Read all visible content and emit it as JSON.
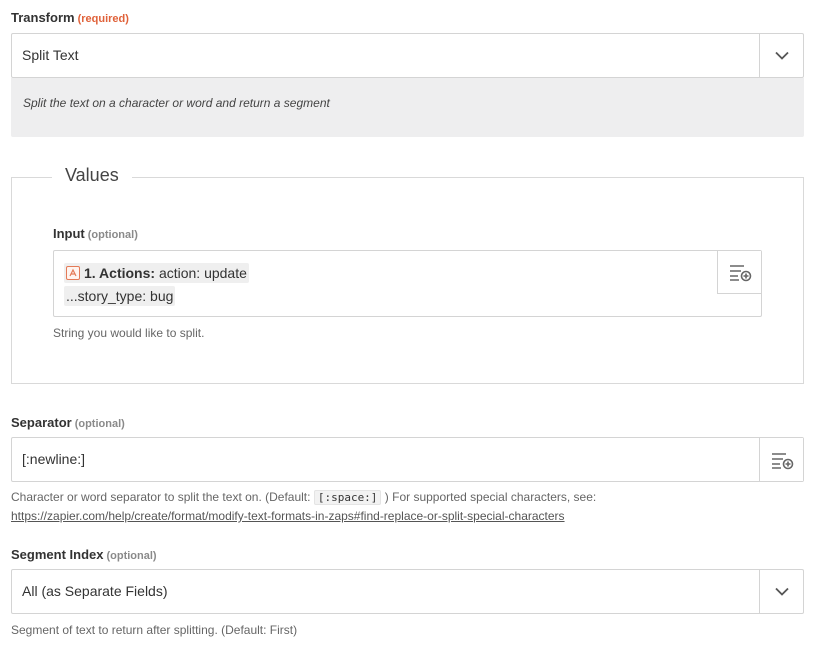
{
  "transform": {
    "label": "Transform",
    "required_tag": "(required)",
    "value": "Split Text",
    "description": "Split the text on a character or word and return a segment",
    "chevron_icon": "chevron-down-icon"
  },
  "values": {
    "legend": "Values",
    "input": {
      "label": "Input",
      "optional_tag": "(optional)",
      "token": {
        "app_icon": "app-icon",
        "step": "1. Actions:",
        "field": "action: update"
      },
      "second_line": "...story_type: bug",
      "help": "String you would like to split.",
      "insert_icon": "list-add-icon"
    }
  },
  "separator": {
    "label": "Separator",
    "optional_tag": "(optional)",
    "value": "[:newline:]",
    "help_prefix": "Character or word separator to split the text on. (Default:",
    "help_code": "[:space:]",
    "help_suffix": ") For supported special characters, see:",
    "help_link": "https://zapier.com/help/create/format/modify-text-formats-in-zaps#find-replace-or-split-special-characters",
    "insert_icon": "list-add-icon"
  },
  "segment_index": {
    "label": "Segment Index",
    "optional_tag": "(optional)",
    "value": "All (as Separate Fields)",
    "help": "Segment of text to return after splitting. (Default: First)",
    "chevron_icon": "chevron-down-icon"
  },
  "colors": {
    "required_accent": "#e0623a",
    "app_icon_accent": "#e47a57",
    "description_bg": "#eeeeef",
    "border": "#d4d4d4"
  }
}
